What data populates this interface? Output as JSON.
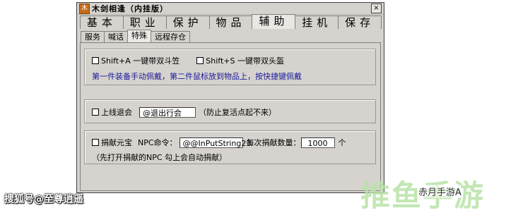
{
  "window": {
    "title": "木剑相逢（内挂版）",
    "icon": "木",
    "close": "×"
  },
  "main_tabs": [
    "基本",
    "职业",
    "保护",
    "物品",
    "辅助",
    "挂机",
    "保存"
  ],
  "main_tabs_active": 4,
  "sub_tabs": [
    "服务",
    "喊话",
    "特殊",
    "远程存仓"
  ],
  "sub_tabs_active": 2,
  "group1": {
    "chk1_label": "Shift+A 一键带双斗笠",
    "chk2_label": "Shift+S 一键带双头盔",
    "note": "第一件装备手动佩戴，第二件鼠标放到物品上，按快捷键佩戴"
  },
  "group2": {
    "chk_label": "上线退会",
    "field_value": "@退出行会",
    "note": "（防止复活点起不来）"
  },
  "group3": {
    "chk_label": "捐献元宝",
    "npc_label": "NPC命令：",
    "npc_value": "@@InPutString23",
    "count_label": "每次捐献数量：",
    "count_value": "1000",
    "unit": "个",
    "note": "（先打开捐献的NPC 勾上会自动捐献）"
  },
  "watermarks": {
    "left": "搜狐号@至尊逍遥",
    "brand_big": "推鱼手游",
    "brand_small": "赤月手游A"
  }
}
